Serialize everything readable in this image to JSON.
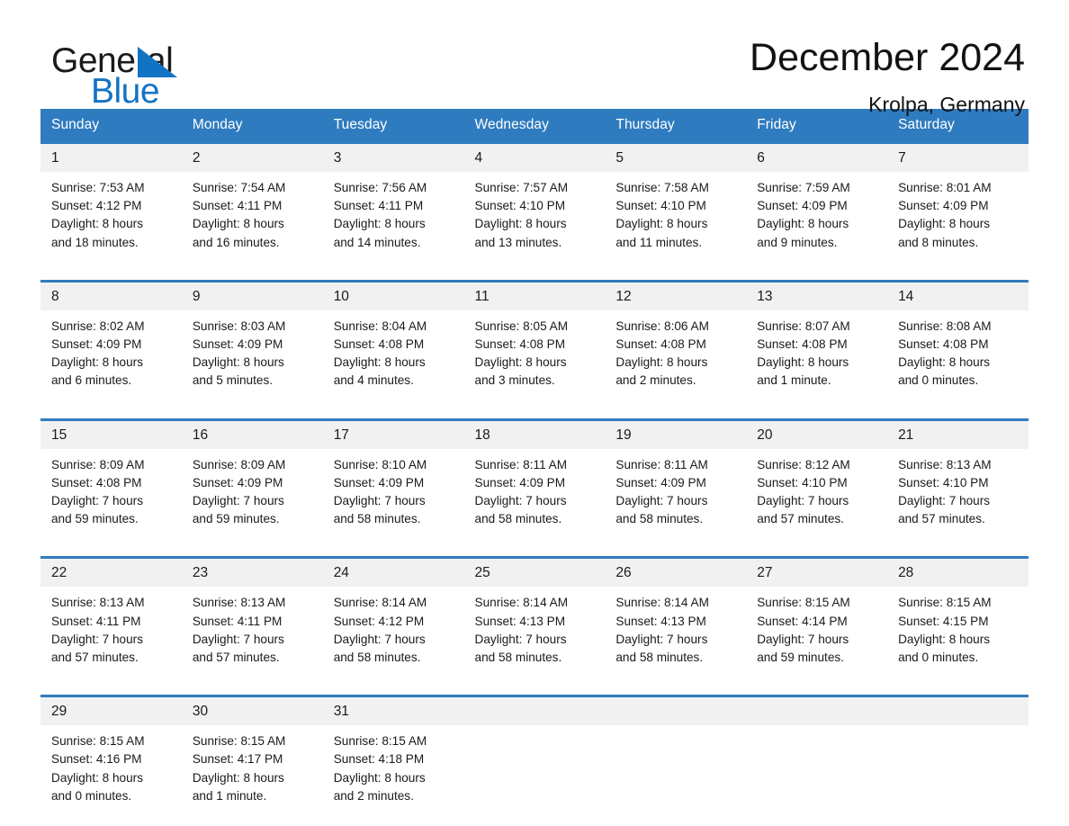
{
  "brand": {
    "word_one": "General",
    "word_two": "Blue",
    "triangle_color": "#1273c4",
    "text_color": "#1a1a1a"
  },
  "header": {
    "month_title": "December 2024",
    "location": "Krolpa, Germany"
  },
  "theme": {
    "header_blue": "#2f7bbf",
    "daynum_band": "#f1f1f1",
    "page_background": "#ffffff",
    "text": "#1a1a1a"
  },
  "calendar": {
    "weekday_headers": [
      "Sunday",
      "Monday",
      "Tuesday",
      "Wednesday",
      "Thursday",
      "Friday",
      "Saturday"
    ],
    "weeks": [
      [
        {
          "day": "1",
          "sunrise": "Sunrise: 7:53 AM",
          "sunset": "Sunset: 4:12 PM",
          "daylight_line1": "Daylight: 8 hours",
          "daylight_line2": "and 18 minutes."
        },
        {
          "day": "2",
          "sunrise": "Sunrise: 7:54 AM",
          "sunset": "Sunset: 4:11 PM",
          "daylight_line1": "Daylight: 8 hours",
          "daylight_line2": "and 16 minutes."
        },
        {
          "day": "3",
          "sunrise": "Sunrise: 7:56 AM",
          "sunset": "Sunset: 4:11 PM",
          "daylight_line1": "Daylight: 8 hours",
          "daylight_line2": "and 14 minutes."
        },
        {
          "day": "4",
          "sunrise": "Sunrise: 7:57 AM",
          "sunset": "Sunset: 4:10 PM",
          "daylight_line1": "Daylight: 8 hours",
          "daylight_line2": "and 13 minutes."
        },
        {
          "day": "5",
          "sunrise": "Sunrise: 7:58 AM",
          "sunset": "Sunset: 4:10 PM",
          "daylight_line1": "Daylight: 8 hours",
          "daylight_line2": "and 11 minutes."
        },
        {
          "day": "6",
          "sunrise": "Sunrise: 7:59 AM",
          "sunset": "Sunset: 4:09 PM",
          "daylight_line1": "Daylight: 8 hours",
          "daylight_line2": "and 9 minutes."
        },
        {
          "day": "7",
          "sunrise": "Sunrise: 8:01 AM",
          "sunset": "Sunset: 4:09 PM",
          "daylight_line1": "Daylight: 8 hours",
          "daylight_line2": "and 8 minutes."
        }
      ],
      [
        {
          "day": "8",
          "sunrise": "Sunrise: 8:02 AM",
          "sunset": "Sunset: 4:09 PM",
          "daylight_line1": "Daylight: 8 hours",
          "daylight_line2": "and 6 minutes."
        },
        {
          "day": "9",
          "sunrise": "Sunrise: 8:03 AM",
          "sunset": "Sunset: 4:09 PM",
          "daylight_line1": "Daylight: 8 hours",
          "daylight_line2": "and 5 minutes."
        },
        {
          "day": "10",
          "sunrise": "Sunrise: 8:04 AM",
          "sunset": "Sunset: 4:08 PM",
          "daylight_line1": "Daylight: 8 hours",
          "daylight_line2": "and 4 minutes."
        },
        {
          "day": "11",
          "sunrise": "Sunrise: 8:05 AM",
          "sunset": "Sunset: 4:08 PM",
          "daylight_line1": "Daylight: 8 hours",
          "daylight_line2": "and 3 minutes."
        },
        {
          "day": "12",
          "sunrise": "Sunrise: 8:06 AM",
          "sunset": "Sunset: 4:08 PM",
          "daylight_line1": "Daylight: 8 hours",
          "daylight_line2": "and 2 minutes."
        },
        {
          "day": "13",
          "sunrise": "Sunrise: 8:07 AM",
          "sunset": "Sunset: 4:08 PM",
          "daylight_line1": "Daylight: 8 hours",
          "daylight_line2": "and 1 minute."
        },
        {
          "day": "14",
          "sunrise": "Sunrise: 8:08 AM",
          "sunset": "Sunset: 4:08 PM",
          "daylight_line1": "Daylight: 8 hours",
          "daylight_line2": "and 0 minutes."
        }
      ],
      [
        {
          "day": "15",
          "sunrise": "Sunrise: 8:09 AM",
          "sunset": "Sunset: 4:08 PM",
          "daylight_line1": "Daylight: 7 hours",
          "daylight_line2": "and 59 minutes."
        },
        {
          "day": "16",
          "sunrise": "Sunrise: 8:09 AM",
          "sunset": "Sunset: 4:09 PM",
          "daylight_line1": "Daylight: 7 hours",
          "daylight_line2": "and 59 minutes."
        },
        {
          "day": "17",
          "sunrise": "Sunrise: 8:10 AM",
          "sunset": "Sunset: 4:09 PM",
          "daylight_line1": "Daylight: 7 hours",
          "daylight_line2": "and 58 minutes."
        },
        {
          "day": "18",
          "sunrise": "Sunrise: 8:11 AM",
          "sunset": "Sunset: 4:09 PM",
          "daylight_line1": "Daylight: 7 hours",
          "daylight_line2": "and 58 minutes."
        },
        {
          "day": "19",
          "sunrise": "Sunrise: 8:11 AM",
          "sunset": "Sunset: 4:09 PM",
          "daylight_line1": "Daylight: 7 hours",
          "daylight_line2": "and 58 minutes."
        },
        {
          "day": "20",
          "sunrise": "Sunrise: 8:12 AM",
          "sunset": "Sunset: 4:10 PM",
          "daylight_line1": "Daylight: 7 hours",
          "daylight_line2": "and 57 minutes."
        },
        {
          "day": "21",
          "sunrise": "Sunrise: 8:13 AM",
          "sunset": "Sunset: 4:10 PM",
          "daylight_line1": "Daylight: 7 hours",
          "daylight_line2": "and 57 minutes."
        }
      ],
      [
        {
          "day": "22",
          "sunrise": "Sunrise: 8:13 AM",
          "sunset": "Sunset: 4:11 PM",
          "daylight_line1": "Daylight: 7 hours",
          "daylight_line2": "and 57 minutes."
        },
        {
          "day": "23",
          "sunrise": "Sunrise: 8:13 AM",
          "sunset": "Sunset: 4:11 PM",
          "daylight_line1": "Daylight: 7 hours",
          "daylight_line2": "and 57 minutes."
        },
        {
          "day": "24",
          "sunrise": "Sunrise: 8:14 AM",
          "sunset": "Sunset: 4:12 PM",
          "daylight_line1": "Daylight: 7 hours",
          "daylight_line2": "and 58 minutes."
        },
        {
          "day": "25",
          "sunrise": "Sunrise: 8:14 AM",
          "sunset": "Sunset: 4:13 PM",
          "daylight_line1": "Daylight: 7 hours",
          "daylight_line2": "and 58 minutes."
        },
        {
          "day": "26",
          "sunrise": "Sunrise: 8:14 AM",
          "sunset": "Sunset: 4:13 PM",
          "daylight_line1": "Daylight: 7 hours",
          "daylight_line2": "and 58 minutes."
        },
        {
          "day": "27",
          "sunrise": "Sunrise: 8:15 AM",
          "sunset": "Sunset: 4:14 PM",
          "daylight_line1": "Daylight: 7 hours",
          "daylight_line2": "and 59 minutes."
        },
        {
          "day": "28",
          "sunrise": "Sunrise: 8:15 AM",
          "sunset": "Sunset: 4:15 PM",
          "daylight_line1": "Daylight: 8 hours",
          "daylight_line2": "and 0 minutes."
        }
      ],
      [
        {
          "day": "29",
          "sunrise": "Sunrise: 8:15 AM",
          "sunset": "Sunset: 4:16 PM",
          "daylight_line1": "Daylight: 8 hours",
          "daylight_line2": "and 0 minutes."
        },
        {
          "day": "30",
          "sunrise": "Sunrise: 8:15 AM",
          "sunset": "Sunset: 4:17 PM",
          "daylight_line1": "Daylight: 8 hours",
          "daylight_line2": "and 1 minute."
        },
        {
          "day": "31",
          "sunrise": "Sunrise: 8:15 AM",
          "sunset": "Sunset: 4:18 PM",
          "daylight_line1": "Daylight: 8 hours",
          "daylight_line2": "and 2 minutes."
        },
        {
          "day": "",
          "sunrise": "",
          "sunset": "",
          "daylight_line1": "",
          "daylight_line2": ""
        },
        {
          "day": "",
          "sunrise": "",
          "sunset": "",
          "daylight_line1": "",
          "daylight_line2": ""
        },
        {
          "day": "",
          "sunrise": "",
          "sunset": "",
          "daylight_line1": "",
          "daylight_line2": ""
        },
        {
          "day": "",
          "sunrise": "",
          "sunset": "",
          "daylight_line1": "",
          "daylight_line2": ""
        }
      ]
    ]
  }
}
